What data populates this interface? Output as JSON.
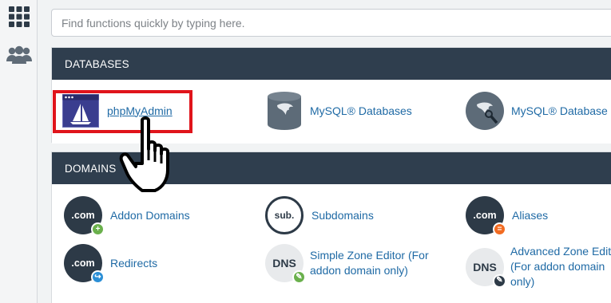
{
  "search": {
    "placeholder": "Find functions quickly by typing here."
  },
  "rail": {
    "icons": [
      "grid-icon",
      "users-icon"
    ]
  },
  "databases": {
    "heading": "DATABASES",
    "items": [
      {
        "label": "phpMyAdmin",
        "icon": "phpmyadmin-icon",
        "highlighted": true
      },
      {
        "label": "MySQL® Databases",
        "icon": "mysql-databases-icon"
      },
      {
        "label": "MySQL® Database",
        "icon": "mysql-database-wizard-icon"
      }
    ]
  },
  "domains": {
    "heading": "DOMAINS",
    "items": [
      {
        "label": "Addon Domains",
        "icon_text": ".com",
        "badge": "+",
        "badge_color": "#6ab04c"
      },
      {
        "label": "Subdomains",
        "icon_text": "sub."
      },
      {
        "label": "Aliases",
        "icon_text": ".com",
        "badge": "=",
        "badge_color": "#f26b21"
      },
      {
        "label": "Redirects",
        "icon_text": ".com",
        "badge": "↪",
        "badge_color": "#2b8fd6"
      },
      {
        "label": "Simple Zone Editor (For addon domain only)",
        "icon_text": "DNS",
        "badge": "✎",
        "badge_color": "#6ab04c"
      },
      {
        "label": "Advanced Zone Editor (For addon domain only)",
        "icon_text": "DNS",
        "badge": "✎",
        "badge_color": "#2d3a47"
      }
    ]
  },
  "colors": {
    "header": "#2f3e4e",
    "link": "#1f6aa5",
    "highlight": "#e0141b"
  }
}
